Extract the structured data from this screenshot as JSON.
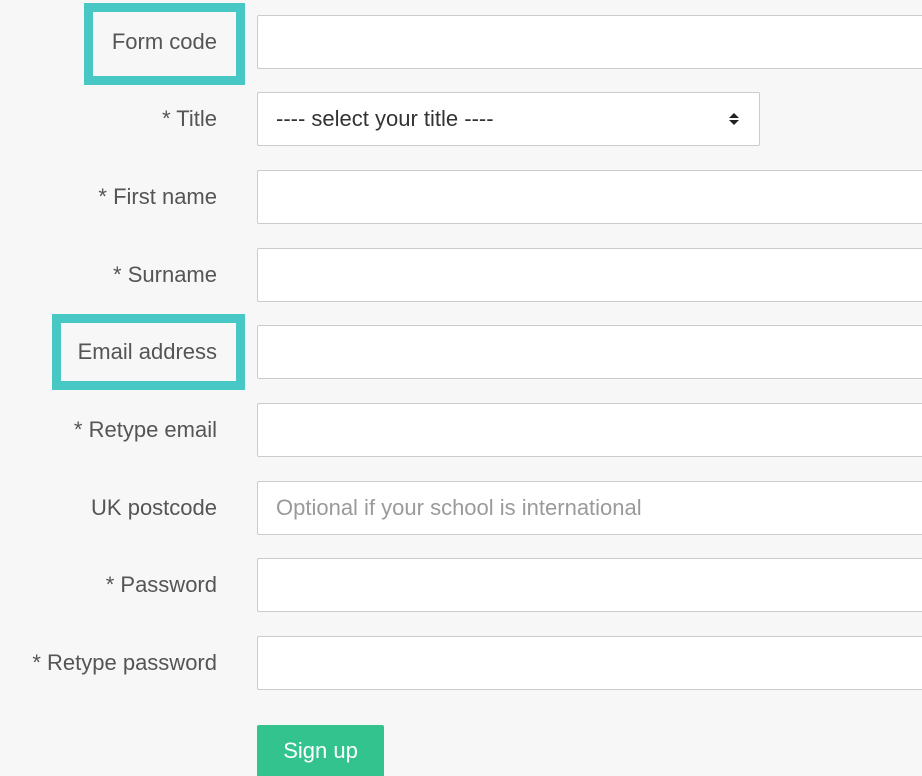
{
  "form": {
    "form_code_label": "Form code",
    "form_code_value": "",
    "title_label": "* Title",
    "title_selected": "---- select your title ----",
    "first_name_label": "* First name",
    "first_name_value": "",
    "surname_label": "* Surname",
    "surname_value": "",
    "email_label": "Email address",
    "email_value": "",
    "retype_email_label": "* Retype email",
    "retype_email_value": "",
    "postcode_label": "UK postcode",
    "postcode_placeholder": "Optional if your school is international",
    "postcode_value": "",
    "password_label": "* Password",
    "password_value": "",
    "retype_password_label": "* Retype password",
    "retype_password_value": "",
    "submit_label": "Sign up"
  },
  "colors": {
    "highlight": "#47c8c5",
    "button": "#33c38e",
    "background": "#f7f7f7"
  },
  "icons": {
    "select_caret": "select-sort-caret-icon"
  }
}
